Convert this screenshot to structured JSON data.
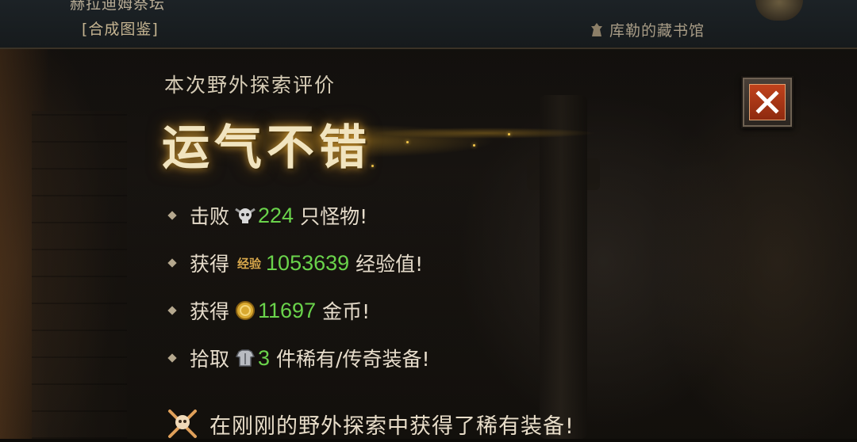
{
  "header": {
    "location_name": "赫拉迪姆祭坛",
    "codex_link": "[合成图鉴]",
    "library_link": "库勒的藏书馆"
  },
  "panel": {
    "subtitle": "本次野外探索评价",
    "rating": "运气不错",
    "close_icon": "close-x-icon",
    "rows": [
      {
        "verb": "击败",
        "icon": "skull-icon",
        "value": "224",
        "suffix": "只怪物!"
      },
      {
        "verb": "获得",
        "icon": "experience-icon",
        "tag": "经验",
        "value": "1053639",
        "suffix": "经验值!"
      },
      {
        "verb": "获得",
        "icon": "gold-coin-icon",
        "value": "11697",
        "suffix": "金币!"
      },
      {
        "verb": "拾取",
        "icon": "armor-icon",
        "value": "3",
        "suffix": "件稀有/传奇装备!"
      }
    ],
    "notice": "在刚刚的野外探索中获得了稀有装备!",
    "notice_icon": "crossed-swords-skull-icon"
  },
  "colors": {
    "value_green": "#6ad34b",
    "title_gold": "#f1e4bf",
    "close_red": "#b83a18"
  }
}
